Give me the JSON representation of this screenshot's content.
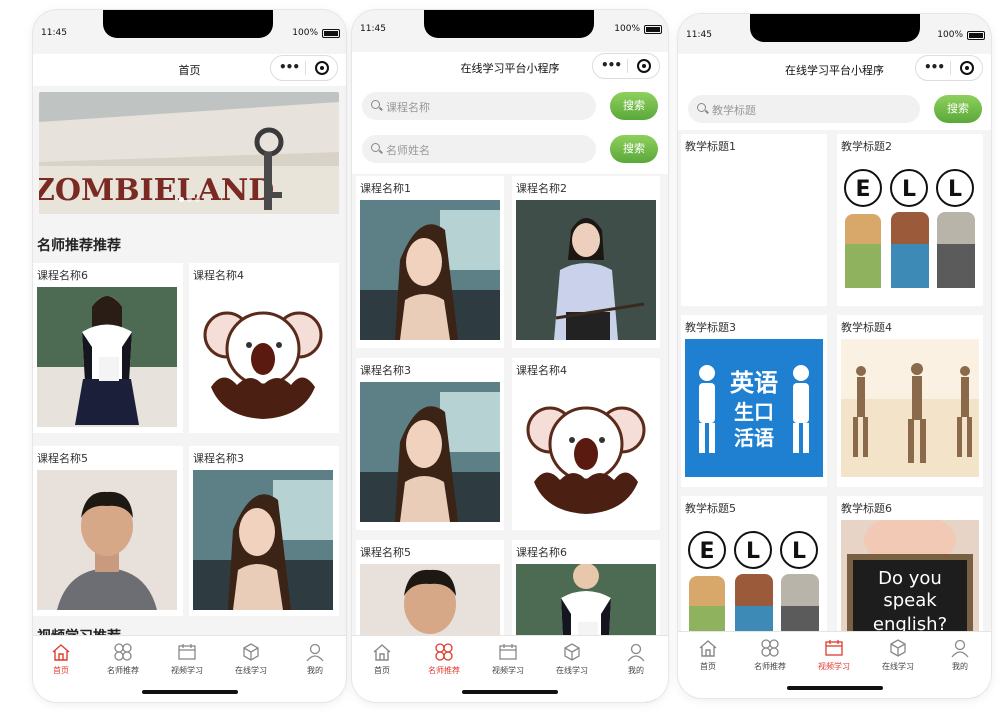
{
  "phones": [
    {
      "status": {
        "time": "11:45",
        "battery": "100%"
      },
      "title": "首页",
      "section_title": "名师推荐推荐",
      "section_title_2": "视频学习推荐",
      "cards": [
        "课程名称6",
        "课程名称4",
        "课程名称5",
        "课程名称3"
      ]
    },
    {
      "status": {
        "time": "11:45",
        "battery": "100%"
      },
      "title": "在线学习平台小程序",
      "search1_placeholder": "课程名称",
      "search2_placeholder": "名师姓名",
      "search_button": "搜索",
      "cards": [
        "课程名称1",
        "课程名称2",
        "课程名称3",
        "课程名称4",
        "课程名称5",
        "课程名称6"
      ]
    },
    {
      "status": {
        "time": "11:45",
        "battery": "100%"
      },
      "title": "在线学习平台小程序",
      "search_placeholder": "教学标题",
      "search_button": "搜索",
      "cards": [
        "教学标题1",
        "教学标题2",
        "教学标题3",
        "教学标题4",
        "教学标题5",
        "教学标题6"
      ],
      "poster_text": [
        "英语",
        "生口",
        "活语"
      ],
      "sign_text": [
        "Do you",
        "speak",
        "english?"
      ]
    }
  ],
  "tabs": [
    "首页",
    "名师推荐",
    "视频学习",
    "在线学习",
    "我的"
  ],
  "active_tabs": [
    0,
    1,
    2
  ],
  "banner_text": "ZOMBIELAND",
  "colors": {
    "active_tab": "#e03a2c",
    "search_button": "#6ab844"
  }
}
